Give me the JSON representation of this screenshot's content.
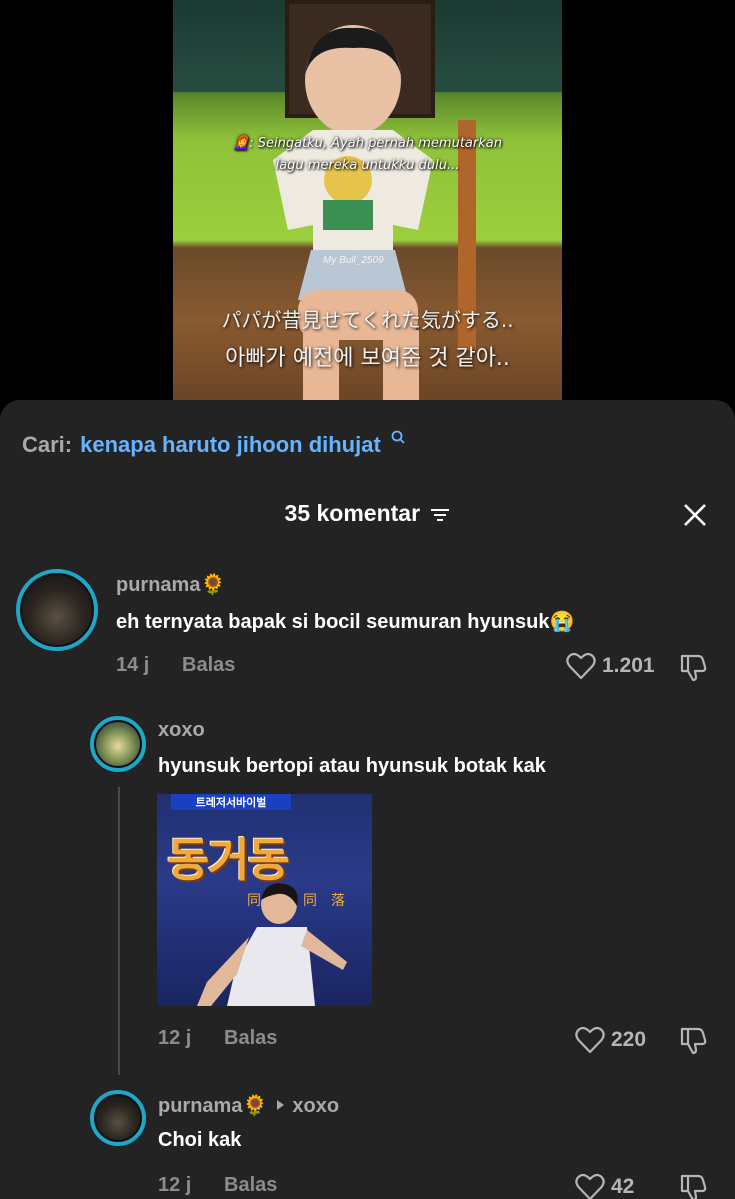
{
  "video": {
    "caption_id_line1": ": Seingatku, Ayah pernah memutarkan",
    "caption_id_line2": "lagu mereka untukku dulu...",
    "watermark": "My Bull_2509",
    "caption_jp": "パパが昔見せてくれた気がする..",
    "caption_kr": "아빠가 예전에 보여준 것 같아.."
  },
  "search": {
    "label": "Cari:",
    "term": "kenapa haruto jihoon dihujat"
  },
  "header": {
    "count_label": "35 komentar"
  },
  "comments": [
    {
      "username": "purnama🌻",
      "text": "eh ternyata bapak si bocil seumuran hyunsuk😭",
      "time": "14 j",
      "reply_label": "Balas",
      "likes": "1.201"
    },
    {
      "username": "xoxo",
      "text": "hyunsuk bertopi atau hyunsuk botak kak",
      "gif_banner": "트레저서바이벌",
      "gif_title": "동거동",
      "gif_sub": "同居同落",
      "time": "12 j",
      "reply_label": "Balas",
      "likes": "220"
    },
    {
      "username": "purnama🌻",
      "reply_to": "xoxo",
      "text": "Choi kak",
      "time": "12 j",
      "reply_label": "Balas",
      "likes": "42"
    }
  ],
  "colors": {
    "sheet_bg": "#232323",
    "accent_link": "#66b3ff",
    "avatar_ring": "#1ea7c8",
    "muted_text": "#8c8c8c"
  },
  "icons": [
    "search-icon",
    "filter-icon",
    "close-icon",
    "heart-icon",
    "dislike-icon",
    "reply-arrow-icon"
  ]
}
